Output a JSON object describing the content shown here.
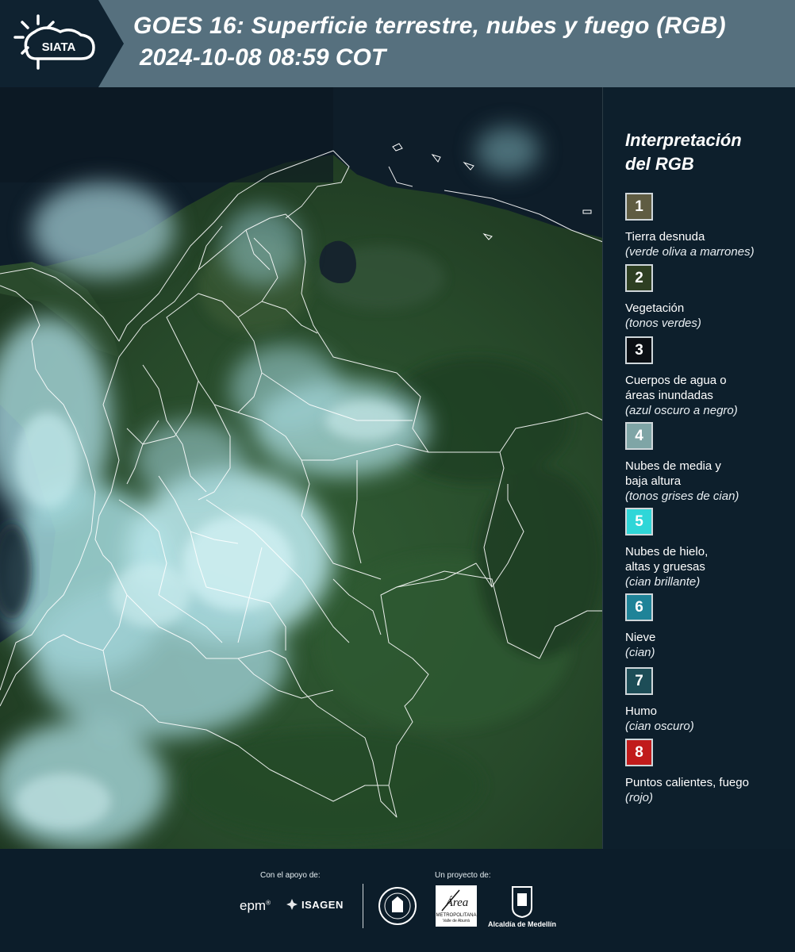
{
  "header": {
    "title_line1": "GOES 16: Superficie terrestre, nubes y fuego (RGB)",
    "title_line2": "2024-10-08 08:59 COT",
    "logo_text": "SIATA",
    "band_color": "#56707e",
    "logo_band_color": "#0f2230"
  },
  "legend": {
    "title_line1": "Interpretación",
    "title_line2": "del RGB",
    "items": [
      {
        "number": "1",
        "label": "Tierra desnuda",
        "sub": "(verde oliva a marrones)",
        "color": "#5f5c42"
      },
      {
        "number": "2",
        "label": "Vegetación",
        "sub": "(tonos verdes)",
        "color": "#2e3f22"
      },
      {
        "number": "3",
        "label": "Cuerpos de agua o áreas inundadas",
        "sub": "(azul oscuro a negro)",
        "color": "#0b0f14"
      },
      {
        "number": "4",
        "label": "Nubes de media y baja altura",
        "sub": "(tonos grises de cian)",
        "color": "#7fa5a6"
      },
      {
        "number": "5",
        "label": "Nubes de hielo, altas y gruesas",
        "sub": "(cian brillante)",
        "color": "#2fd6d8"
      },
      {
        "number": "6",
        "label": "Nieve",
        "sub": "(cian)",
        "color": "#1f8398"
      },
      {
        "number": "7",
        "label": "Humo",
        "sub": "(cian oscuro)",
        "color": "#1d4d57"
      },
      {
        "number": "8",
        "label": "Puntos calientes, fuego",
        "sub": "(rojo)",
        "color": "#c11b1b"
      }
    ]
  },
  "footer": {
    "support_label": "Con el apoyo de:",
    "project_label": "Un proyecto de:",
    "epm": "epm",
    "isagen": "ISAGEN",
    "amva_title": "Área",
    "amva_sub": "METROPOLITANA",
    "amva_sub2": "Valle de Aburrá",
    "medellin": "Alcaldía de Medellín"
  }
}
